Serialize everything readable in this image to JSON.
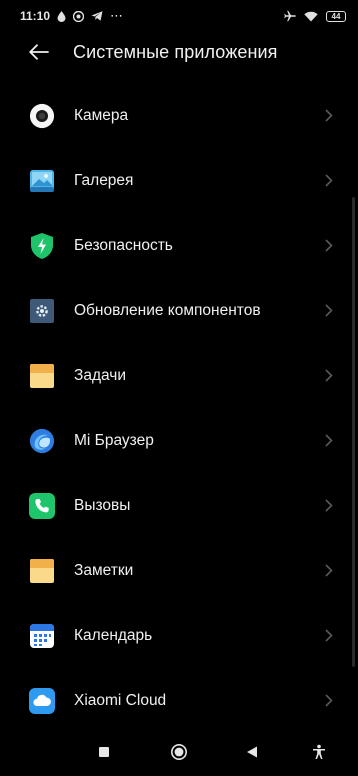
{
  "status_bar": {
    "time": "11:10",
    "battery": "44",
    "more_icon": "⋯"
  },
  "header": {
    "title": "Системные приложения"
  },
  "apps": [
    {
      "label": "Камера",
      "icon": "camera-icon"
    },
    {
      "label": "Галерея",
      "icon": "gallery-icon"
    },
    {
      "label": "Безопасность",
      "icon": "security-icon"
    },
    {
      "label": "Обновление компонентов",
      "icon": "component-update-icon"
    },
    {
      "label": "Задачи",
      "icon": "tasks-icon"
    },
    {
      "label": "Mi Браузер",
      "icon": "mi-browser-icon"
    },
    {
      "label": "Вызовы",
      "icon": "phone-icon"
    },
    {
      "label": "Заметки",
      "icon": "notes-icon"
    },
    {
      "label": "Календарь",
      "icon": "calendar-icon"
    },
    {
      "label": "Xiaomi Cloud",
      "icon": "cloud-icon"
    }
  ],
  "colors": {
    "background": "#000000",
    "text": "#f0f0f0",
    "chevron": "#5a5a5a"
  }
}
